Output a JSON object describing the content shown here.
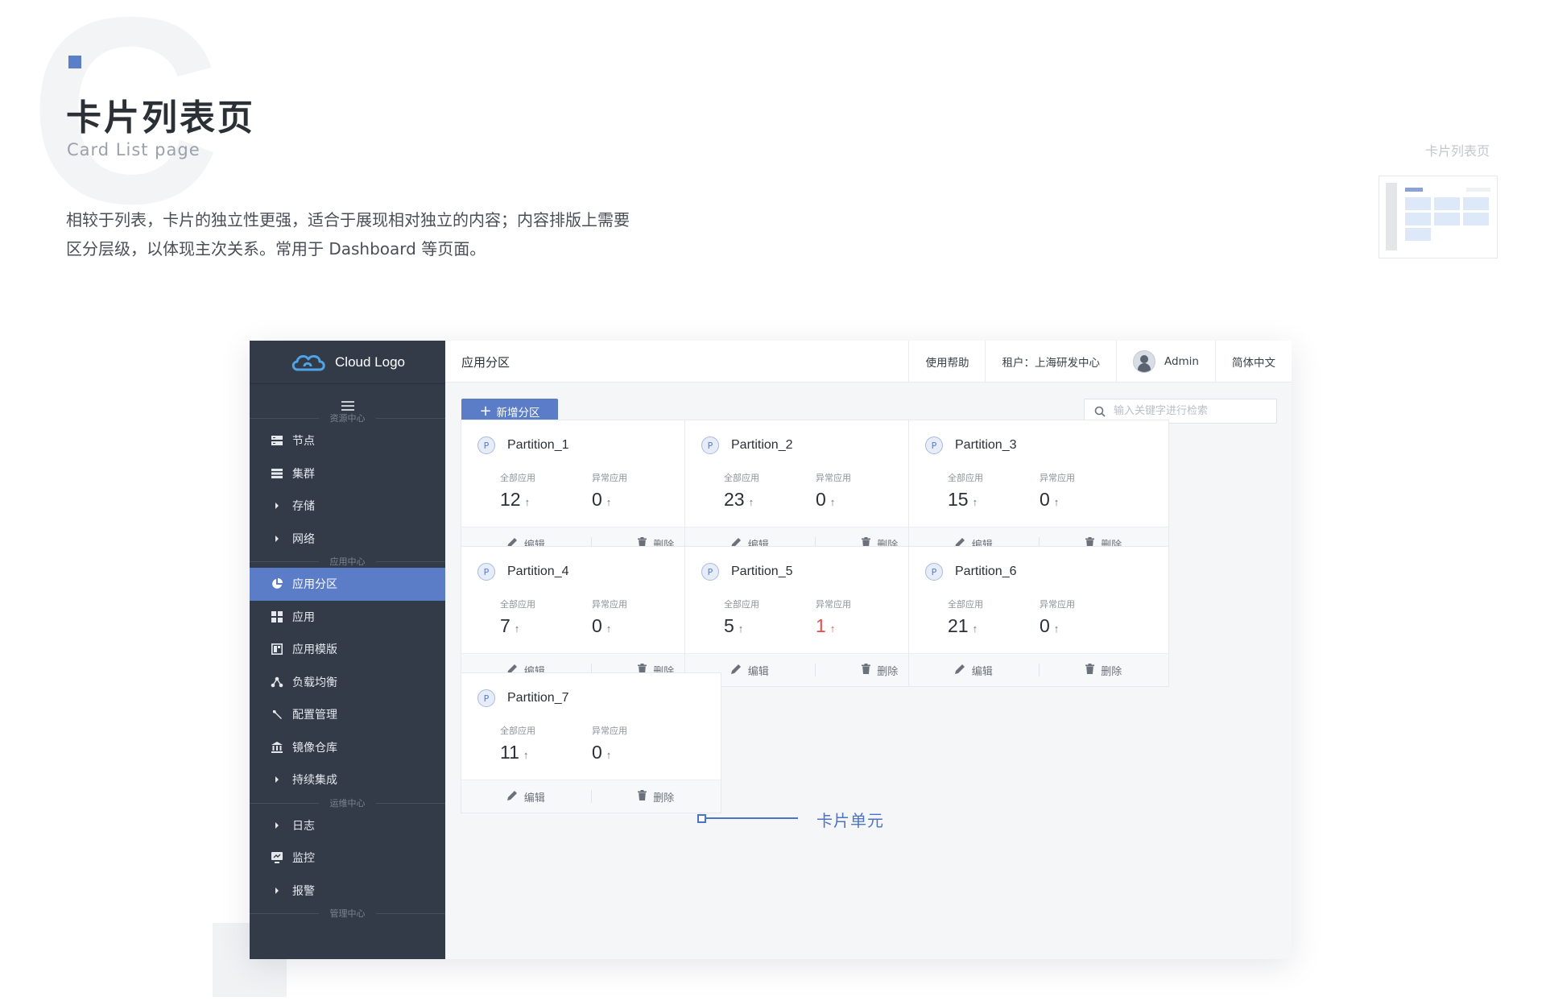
{
  "header": {
    "watermark_letter": "C",
    "title": "卡片列表页",
    "subtitle": "Card List page",
    "description_line1": "相较于列表，卡片的独立性更强，适合于展现相对独立的内容；内容排版上需要",
    "description_line2": "区分层级，以体现主次关系。常用于 Dashboard 等页面。",
    "thumbnail_caption": "卡片列表页"
  },
  "colors": {
    "accent": "#5b7cc6",
    "sidebar_bg": "#343b48",
    "alert": "#e74c4c",
    "callout": "#4e73c4"
  },
  "app": {
    "logo_text": "Cloud Logo",
    "menu_icon": "hamburger-icon",
    "sidebar": {
      "sections": [
        {
          "label": "资源中心",
          "items": [
            {
              "label": "节点",
              "icon": "server-icon"
            },
            {
              "label": "集群",
              "icon": "list-icon"
            },
            {
              "label": "存储",
              "icon": "caret-right-icon"
            },
            {
              "label": "网络",
              "icon": "caret-right-icon"
            }
          ]
        },
        {
          "label": "应用中心",
          "items": [
            {
              "label": "应用分区",
              "icon": "pie-icon",
              "active": true
            },
            {
              "label": "应用",
              "icon": "grid-icon"
            },
            {
              "label": "应用模版",
              "icon": "template-icon"
            },
            {
              "label": "负载均衡",
              "icon": "share-icon"
            },
            {
              "label": "配置管理",
              "icon": "wrench-icon"
            },
            {
              "label": "镜像仓库",
              "icon": "bank-icon"
            },
            {
              "label": "持续集成",
              "icon": "caret-right-icon"
            }
          ]
        },
        {
          "label": "运维中心",
          "items": [
            {
              "label": "日志",
              "icon": "caret-right-icon"
            },
            {
              "label": "监控",
              "icon": "monitor-icon"
            },
            {
              "label": "报警",
              "icon": "caret-right-icon"
            }
          ]
        },
        {
          "label": "管理中心",
          "items": []
        }
      ]
    },
    "topbar": {
      "breadcrumb": "应用分区",
      "help": "使用帮助",
      "tenant": "租户：上海研发中心",
      "user": "Admin",
      "language": "简体中文"
    },
    "toolbar": {
      "add_label": "新增分区",
      "search_placeholder": "输入关键字进行检索"
    },
    "card_labels": {
      "total": "全部应用",
      "abnormal": "异常应用",
      "edit": "编辑",
      "delete": "删除",
      "badge": "P"
    },
    "cards": [
      {
        "name": "Partition_1",
        "total": "12",
        "abnormal": "0"
      },
      {
        "name": "Partition_2",
        "total": "23",
        "abnormal": "0"
      },
      {
        "name": "Partition_3",
        "total": "15",
        "abnormal": "0"
      },
      {
        "name": "Partition_4",
        "total": "7",
        "abnormal": "0"
      },
      {
        "name": "Partition_5",
        "total": "5",
        "abnormal": "1"
      },
      {
        "name": "Partition_6",
        "total": "21",
        "abnormal": "0"
      },
      {
        "name": "Partition_7",
        "total": "11",
        "abnormal": "0"
      }
    ]
  },
  "callout": {
    "label": "卡片单元"
  }
}
